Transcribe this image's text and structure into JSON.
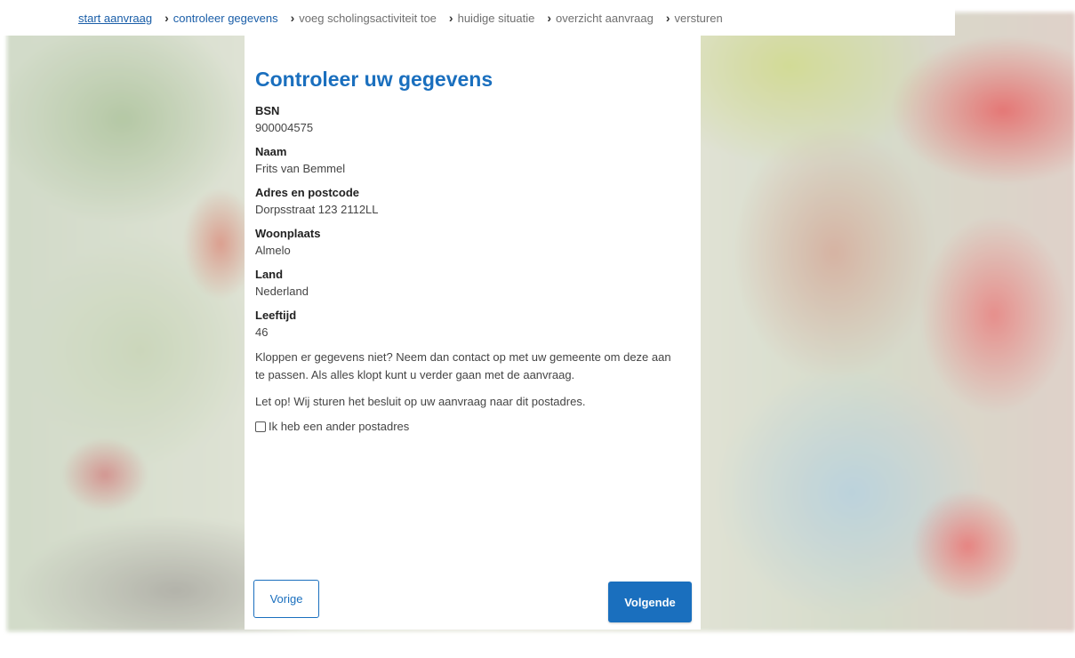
{
  "breadcrumb": {
    "items": [
      {
        "label": "start aanvraag",
        "state": "link"
      },
      {
        "label": "controleer gegevens",
        "state": "current"
      },
      {
        "label": "voeg scholingsactiviteit toe",
        "state": "future"
      },
      {
        "label": "huidige situatie",
        "state": "future"
      },
      {
        "label": "overzicht aanvraag",
        "state": "future"
      },
      {
        "label": "versturen",
        "state": "future"
      }
    ],
    "separator_icon": "chevron-right-icon"
  },
  "card": {
    "title": "Controleer uw gegevens",
    "fields": [
      {
        "label": "BSN",
        "value": "900004575"
      },
      {
        "label": "Naam",
        "value": "Frits van Bemmel"
      },
      {
        "label": "Adres en postcode",
        "value": "Dorpsstraat 123 2112LL"
      },
      {
        "label": "Woonplaats",
        "value": "Almelo"
      },
      {
        "label": "Land",
        "value": "Nederland"
      },
      {
        "label": "Leeftijd",
        "value": "46"
      }
    ],
    "info_text": "Kloppen er gegevens niet? Neem dan contact op met uw gemeente om deze aan te passen. Als alles klopt kunt u verder gaan met de aanvraag.",
    "notice_text": "Let op! Wij sturen het besluit op uw aanvraag naar dit postadres.",
    "checkbox": {
      "label": "Ik heb een ander postadres",
      "checked": false
    }
  },
  "buttons": {
    "previous_label": "Vorige",
    "next_label": "Volgende"
  },
  "colors": {
    "primary": "#1a6fbe",
    "link": "#1a5ea8"
  }
}
